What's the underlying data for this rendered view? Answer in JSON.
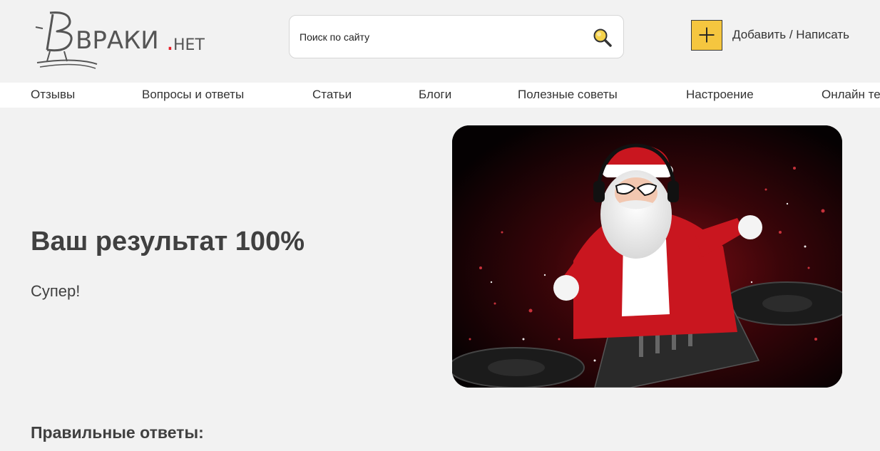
{
  "header": {
    "logo_text": "ВРАКИ.НЕТ",
    "logo_main": "ВРАКИ",
    "logo_dot": ".",
    "logo_suffix": "НЕТ",
    "search_placeholder": "Поиск по сайту",
    "search_icon": "search-icon",
    "add_icon": "plus-icon",
    "add_label": "Добавить / Написать"
  },
  "nav": {
    "items": [
      "Отзывы",
      "Вопросы и ответы",
      "Статьи",
      "Блоги",
      "Полезные советы",
      "Настроение",
      "Онлайн те"
    ]
  },
  "result": {
    "title": "Ваш результат 100%",
    "subtitle": "Супер!",
    "image": "santa-dj-image"
  },
  "answers": {
    "title": "Правильные ответы:"
  },
  "colors": {
    "background": "#f2f2f2",
    "accent_yellow": "#f5c63f",
    "logo_dot_red": "#e8202a",
    "text": "#404040"
  }
}
